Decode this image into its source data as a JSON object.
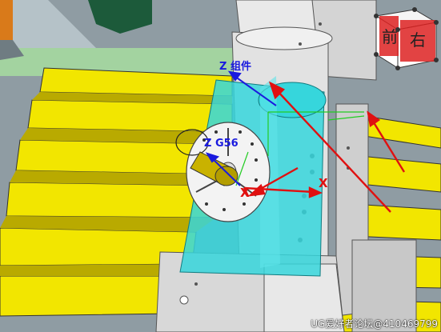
{
  "viewport": {
    "labels": {
      "z_component": "Z 组件",
      "z_g56": "Z G56",
      "x_red_1": "X",
      "x_red_2": "X"
    },
    "view_cube": {
      "front": "前",
      "right": "右"
    }
  },
  "watermark": "UG爱好者论坛@410469799",
  "colors": {
    "table_slot": "#f2e600",
    "table_shadow": "#b9aa00",
    "spindle_head": "#36d6dc",
    "machine_body": "#e6e6e6",
    "csys_label": "#1a1adf",
    "annotation_arrow": "#e01010",
    "grass_bg": "#a8d6a0"
  }
}
